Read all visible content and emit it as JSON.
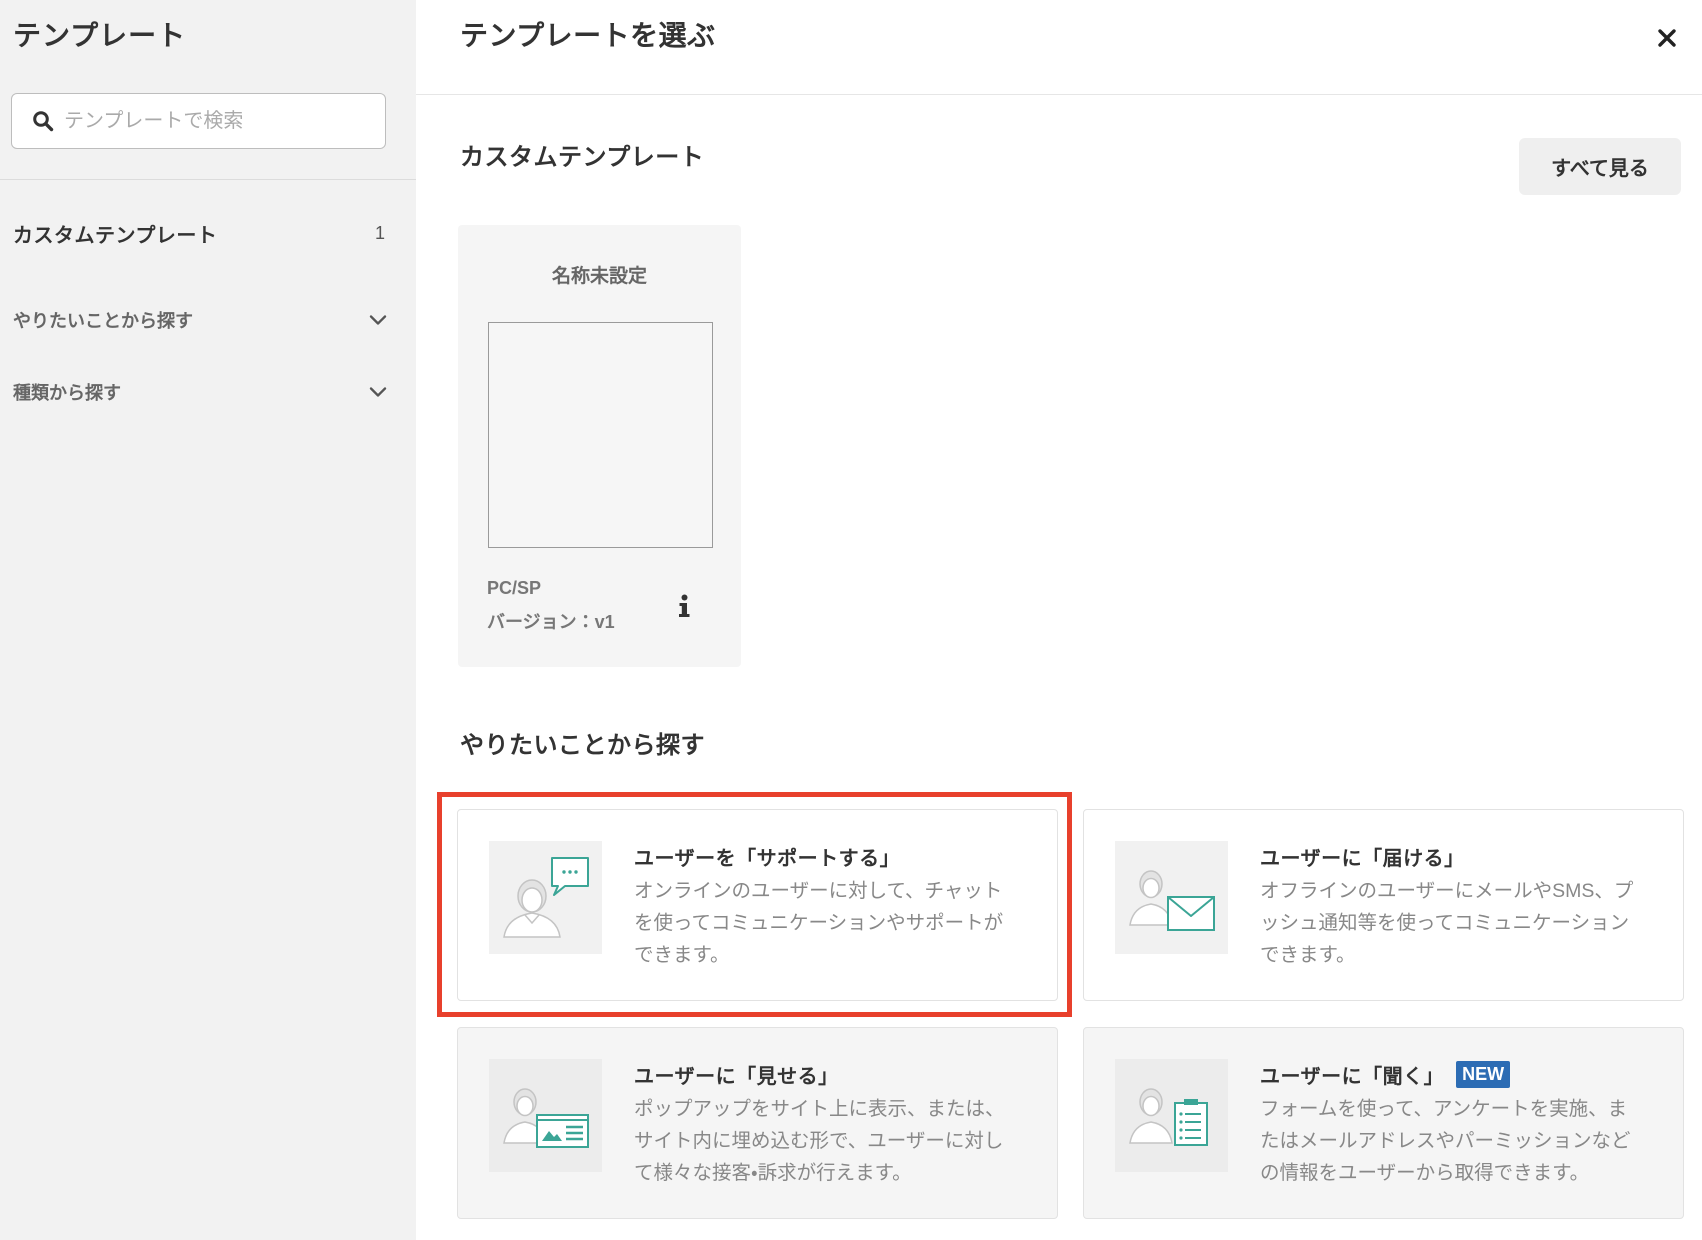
{
  "sidebar": {
    "title": "テンプレート",
    "search": {
      "placeholder": "テンプレートで検索",
      "value": "",
      "icon": "search-icon"
    },
    "items": [
      {
        "label": "カスタムテンプレート",
        "count": "1"
      },
      {
        "label": "やりたいことから探す",
        "icon": "chevron-down-icon"
      },
      {
        "label": "種類から探す",
        "icon": "chevron-down-icon"
      }
    ]
  },
  "header": {
    "title": "テンプレートを選ぶ",
    "close_icon": "close-icon"
  },
  "custom_section": {
    "title": "カスタムテンプレート",
    "see_all_label": "すべて見る",
    "templates": [
      {
        "name": "名称未設定",
        "device": "PC/SP",
        "version": "バージョン：v1",
        "info_icon": "info-icon"
      }
    ]
  },
  "purpose_section": {
    "title": "やりたいことから探す",
    "cards": [
      {
        "title": "ユーザーを「サポートする」",
        "description": "オンラインのユーザーに対して、チャットを使ってコミュニケーションやサポートができます。",
        "icon": "person-chat-bubble-icon"
      },
      {
        "title": "ユーザーに「届ける」",
        "description": "オフラインのユーザーにメールやSMS、プッシュ通知等を使ってコミュニケーションできます。",
        "icon": "person-envelope-icon"
      },
      {
        "title": "ユーザーに「見せる」",
        "description": "ポップアップをサイト上に表示、または、サイト内に埋め込む形で、ユーザーに対して様々な接客・訴求が行えます。",
        "icon": "person-image-card-icon"
      },
      {
        "title": "ユーザーに「聞く」",
        "description": "フォームを使って、アンケートを実施、またはメールアドレスやパーミッションなどの情報をユーザーから取得できます。",
        "icon": "person-clipboard-icon",
        "badge": "NEW"
      }
    ]
  },
  "colors": {
    "accent": "#3ba596",
    "highlight": "#e8402c",
    "badge": "#2c6cb4",
    "sidebar_bg": "#f2f2f2"
  }
}
